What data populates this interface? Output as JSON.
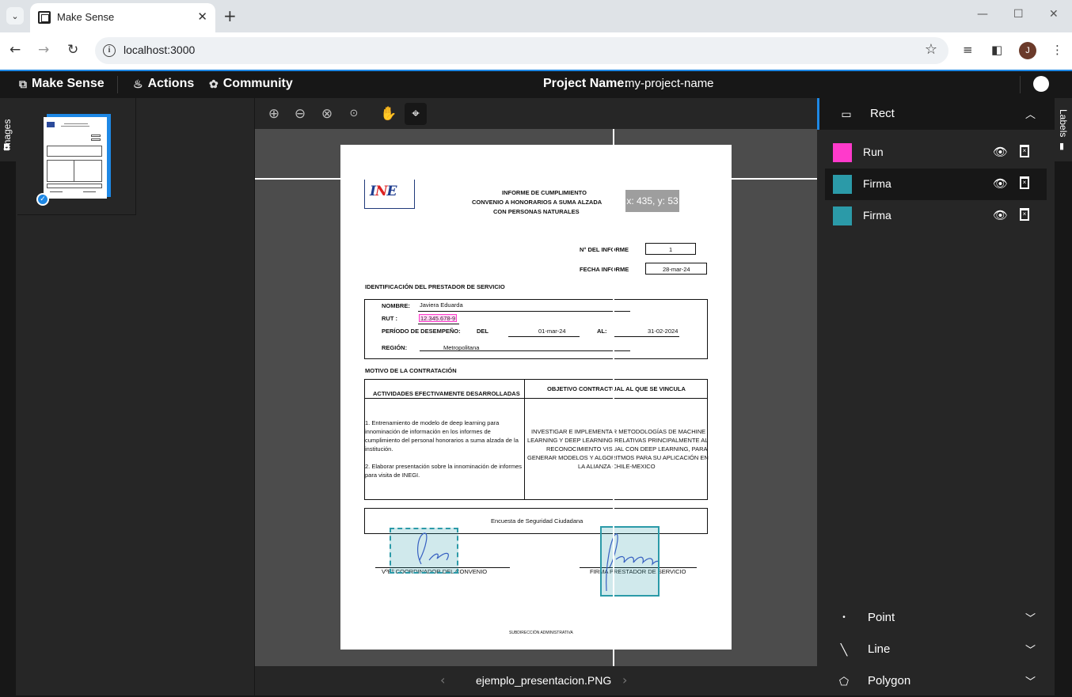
{
  "browser": {
    "tab_title": "Make Sense",
    "url": "localhost:3000",
    "profile_initial": "J"
  },
  "appbar": {
    "brand": "Make Sense",
    "actions": "Actions",
    "community": "Community",
    "project_label": "Project Name:",
    "project_name": "my-project-name"
  },
  "left_panel": {
    "tab_label": "Images"
  },
  "editor": {
    "tools": [
      "zoom-in",
      "zoom-out",
      "zoom-fit",
      "zoom-max",
      "hand",
      "crosshair"
    ],
    "active_tool": "crosshair",
    "filename": "ejemplo_presentacion.PNG",
    "cursor_readout": "x: 435, y: 53"
  },
  "document": {
    "header_line1": "INFORME DE CUMPLIMIENTO",
    "header_line2": "CONVENIO A HONORARIOS A SUMA ALZADA",
    "header_line3": "CON PERSONAS NATURALES",
    "n_informe_label": "N° DEL INFORME",
    "n_informe_value": "1",
    "fecha_label": "FECHA INFORME",
    "fecha_value": "28-mar-24",
    "ident_title": "IDENTIFICACIÓN DEL PRESTADOR DE SERVICIO",
    "nombre_label": "NOMBRE:",
    "nombre_value": "Javiera Eduarda",
    "rut_label": "RUT :",
    "rut_value": "12.345.678-9",
    "periodo_label": "PERÍODO DE DESEMPEÑO:",
    "del_label": "DEL",
    "del_value": "01-mar-24",
    "al_label": "AL:",
    "al_value": "31-02-2024",
    "region_label": "REGIÓN:",
    "region_value": "Metropolitana",
    "motivo_title": "MOTIVO DE LA CONTRATACIÓN",
    "col1_header": "ACTIVIDADES EFECTIVAMENTE DESARROLLADAS",
    "col2_header": "OBJETIVO CONTRACTUAL AL QUE SE VINCULA",
    "activity1_l1": "1. Entrenamiento de modelo de deep learning para",
    "activity1_l2": "innominación de información en los informes de",
    "activity1_l3": "cumplimiento del personal honorarios a suma alzada de la",
    "activity1_l4": "institución.",
    "activity2_l1": "2. Elaborar presentación sobre la innominación de informes",
    "activity2_l2": "para visita de INEGI.",
    "objective_l1": "INVESTIGAR E IMPLEMENTAR METODOLOGÍAS DE MACHINE",
    "objective_l2": "LEARNING Y DEEP LEARNING RELATIVAS PRINCIPALMENTE AL",
    "objective_l3": "RECONOCIMIENTO VISUAL CON DEEP LEARNING, PARA",
    "objective_l4": "GENERAR MODELOS Y ALGORITMOS PARA SU APLICACIÓN EN",
    "objective_l5": "LA ALIANZA CHILE-MEXICO",
    "encuesta": "Encuesta de Seguridad Ciudadana",
    "sign_left": "VºBº COORDINADOR DEL CONVENIO",
    "sign_right": "FIRMA PRESTADOR DE SERVICIO",
    "footer": "SUBDIRECCIÓN ADMINISTRATIVA"
  },
  "labels_panel": {
    "tab_label": "Labels",
    "rect_section": "Rect",
    "labels": [
      {
        "name": "Run",
        "color": "#ff3acb"
      },
      {
        "name": "Firma",
        "color": "#2b9aa8"
      },
      {
        "name": "Firma",
        "color": "#2b9aa8"
      }
    ],
    "point_section": "Point",
    "line_section": "Line",
    "polygon_section": "Polygon"
  }
}
